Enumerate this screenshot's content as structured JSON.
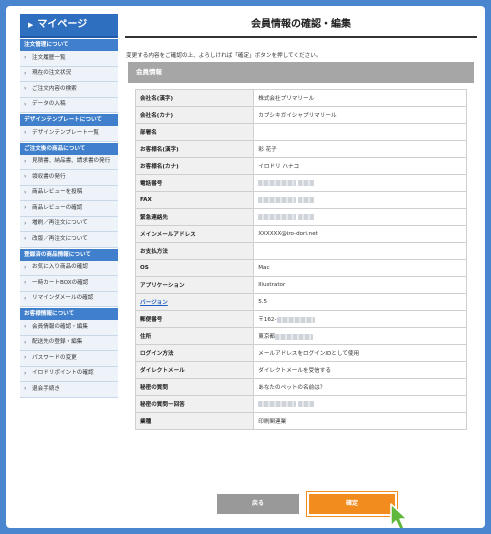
{
  "sidebar": {
    "title": "マイページ",
    "groups": [
      {
        "heading": "注文管理について",
        "items": [
          "注文履歴一覧",
          "現在の注文状況",
          "ご注文内容の検索",
          "データの入稿"
        ]
      },
      {
        "heading": "デザインテンプレートについて",
        "items": [
          "デザインテンプレート一覧"
        ]
      },
      {
        "heading": "ご注文後の商品について",
        "items": [
          "見積書、納品書、請求書の発行",
          "領収書の発行",
          "商品レビューを投稿",
          "商品レビューの確認",
          "増刷／再注文について",
          "改版／再注文について"
        ]
      },
      {
        "heading": "登録済の商品情報について",
        "items": [
          "お気に入り商品の確認",
          "一時カートBOXの確認",
          "リマインダメールの確認"
        ]
      },
      {
        "heading": "お客様情報について",
        "items": [
          "会員情報の確認・編集",
          "配送先の登録・編集",
          "パスワードの変更",
          "イロドリポイントの確認",
          "退会手続き"
        ]
      }
    ]
  },
  "main": {
    "title": "会員情報の確認・編集",
    "intro": "変更する内容をご確認の上、よろしければ「確定」ボタンを押してください。",
    "section": "会員情報",
    "rows": [
      {
        "label": "会社名(漢字)",
        "value": "株式会社プリマリール"
      },
      {
        "label": "会社名(カナ)",
        "value": "カブシキガイシャプリマリール"
      },
      {
        "label": "部署名",
        "value": ""
      },
      {
        "label": "お客様名(漢字)",
        "value": "彩 花子"
      },
      {
        "label": "お客様名(カナ)",
        "value": "イロドリ ハナコ"
      },
      {
        "label": "電話番号",
        "value": "",
        "masked": true
      },
      {
        "label": "FAX",
        "value": "",
        "masked": true
      },
      {
        "label": "緊急連絡先",
        "value": "",
        "masked": true
      },
      {
        "label": "メインメールアドレス",
        "value": "XXXXXX@iro-dori.net"
      },
      {
        "label": "お支払方法",
        "value": ""
      },
      {
        "label": "OS",
        "value": "Mac"
      },
      {
        "label": "アプリケーション",
        "value": "Illustrator"
      },
      {
        "label": "バージョン",
        "value": "5.5",
        "link": true
      },
      {
        "label": "郵便番号",
        "value": "〒162-",
        "masked_tail": true
      },
      {
        "label": "住所",
        "value": "東京都",
        "masked_tail": true
      },
      {
        "label": "ログイン方法",
        "value": "メールアドレスをログインIDとして使用"
      },
      {
        "label": "ダイレクトメール",
        "value": "ダイレクトメールを受信する"
      },
      {
        "label": "秘密の質問",
        "value": "あなたのペットの名前は？"
      },
      {
        "label": "秘密の質問ー回答",
        "value": "",
        "masked": true
      },
      {
        "label": "業種",
        "value": "印刷関連業"
      }
    ],
    "back_label": "戻る",
    "confirm_label": "確定"
  },
  "colors": {
    "accent": "#2f6fc0",
    "confirm": "#f28c1e",
    "back": "#999999",
    "background": "#4a86cf"
  }
}
